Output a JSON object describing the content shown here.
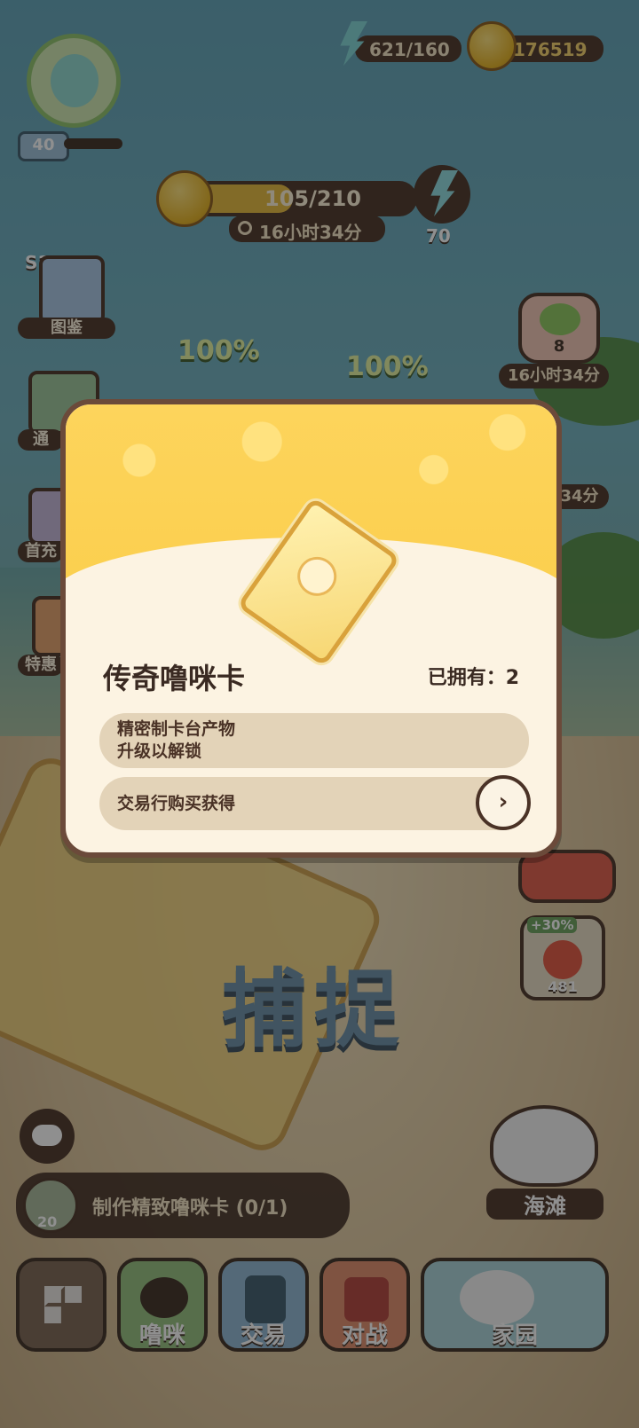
{
  "hud": {
    "level": "40",
    "energy": "621/160",
    "coins": "176519",
    "card_progress": "105/210",
    "card_timer": "16小时34分",
    "bolt_count": "70",
    "clover_count": "8",
    "clover_timer": "16小时34分",
    "right_timer_partial": "34分"
  },
  "side_menu": [
    {
      "label": "图鉴",
      "tag": "S1"
    },
    {
      "label": "通"
    },
    {
      "label": "首充"
    },
    {
      "label": "特惠"
    }
  ],
  "percent_labels": [
    "100%",
    "100%"
  ],
  "modal": {
    "title": "传奇噜咪卡",
    "owned_label": "已拥有：2",
    "source_1_line1": "精密制卡台产物",
    "source_1_line2": "升级以解锁",
    "source_2": "交易行购买获得",
    "go_glyph": "›"
  },
  "right_items": {
    "bonus": "+30%",
    "candy_count": "481",
    "location": "海滩"
  },
  "catch_label": "捕捉",
  "task": {
    "text": "制作精致噜咪卡 (0/1)",
    "count": "20"
  },
  "bottom_tabs": [
    {
      "label": ""
    },
    {
      "label": "噜咪"
    },
    {
      "label": "交易"
    },
    {
      "label": "对战"
    },
    {
      "label": "家园"
    }
  ]
}
